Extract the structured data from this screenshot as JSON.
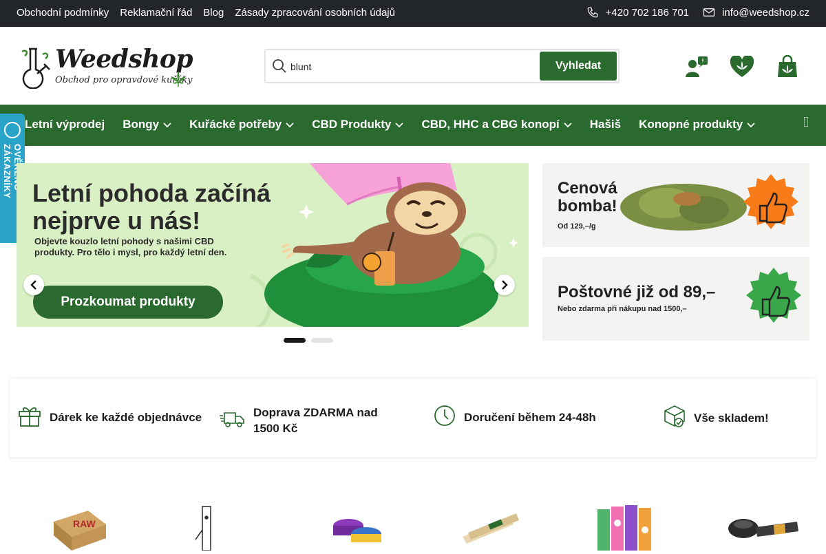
{
  "topbar": {
    "links": [
      "Obchodní podmínky",
      "Reklamační řád",
      "Blog",
      "Zásady zpracování osobních údajů"
    ],
    "phone": "+420 702 186 701",
    "email": "info@weedshop.cz"
  },
  "header": {
    "logo_brand": "Weedshop",
    "logo_tagline": "Obchod pro opravdové kuřáky",
    "search_value": "blunt",
    "search_button": "Vyhledat"
  },
  "nav": {
    "items": [
      {
        "label": "Letní výprodej",
        "has_dropdown": false
      },
      {
        "label": "Bongy",
        "has_dropdown": true
      },
      {
        "label": "Kuřácké potřeby",
        "has_dropdown": true
      },
      {
        "label": "CBD Produkty",
        "has_dropdown": true
      },
      {
        "label": "CBD, HHC a CBG konopí",
        "has_dropdown": true
      },
      {
        "label": "Hašiš",
        "has_dropdown": false
      },
      {
        "label": "Konopné produkty",
        "has_dropdown": true
      }
    ]
  },
  "verified_badge": "OVĚŘENO ZÁKAZNÍKY",
  "hero": {
    "title": "Letní pohoda začíná nejprve u nás!",
    "subtitle": "Objevte kouzlo letní pohody s našimi CBD produkty. Pro tělo i mysl, pro každý letní den.",
    "button": "Prozkoumat produkty"
  },
  "promos": [
    {
      "title": "Cenová bomba!",
      "sub": "Od 129,–/g"
    },
    {
      "title": "Poštovné již od 89,–",
      "sub": "Nebo zdarma při nákupu nad 1500,–"
    }
  ],
  "benefits": [
    {
      "icon": "gift-icon",
      "text": "Dárek ke každé objednávce"
    },
    {
      "icon": "delivery-truck-icon",
      "text": "Doprava ZDARMA nad 1500 Kč"
    },
    {
      "icon": "clock-icon",
      "text": "Doručení během 24-48h"
    },
    {
      "icon": "box-check-icon",
      "text": "Vše skladem!"
    }
  ],
  "colors": {
    "topbar": "#222629",
    "brand_green": "#2a6a2f",
    "hero_bg": "#d9f0c4",
    "verified_blue": "#2aa3c9"
  }
}
